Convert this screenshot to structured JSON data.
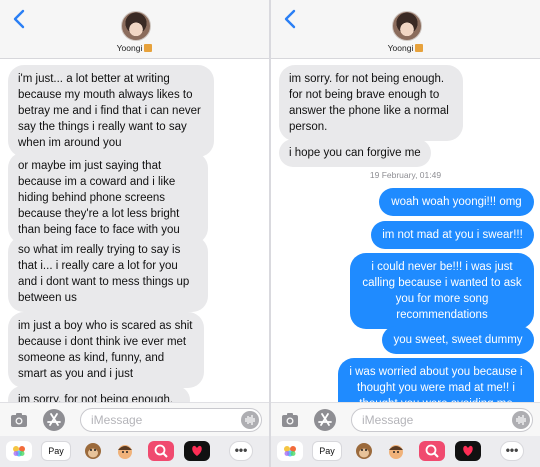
{
  "contact": {
    "name": "Yoongi"
  },
  "left": {
    "messages": [
      {
        "text": "i'm just... a lot better at writing because my mouth always likes to betray me and i find that i can never say the things i really want to say when im around you"
      },
      {
        "text": "or maybe im just saying that because im a coward and i like hiding behind phone screens because they're a lot less bright than being face to face with you"
      },
      {
        "text": "so what im really trying to say is that i... i really care a lot for you and i dont want to mess things up between us"
      },
      {
        "text": "im just a boy who is scared as shit because i dont think ive ever met someone as kind, funny, and smart as you and i just"
      },
      {
        "text": "im sorry. for not being enough."
      }
    ]
  },
  "right": {
    "incoming": [
      {
        "text": "im sorry. for not being enough. for not being brave enough to answer the phone like a normal person."
      },
      {
        "text": "i hope you can forgive me"
      }
    ],
    "timestamp": "19 February, 01:49",
    "outgoing": [
      {
        "text": "woah woah yoongi!!! omg"
      },
      {
        "text": "im not mad at you i swear!!!"
      },
      {
        "text": "i could never be!!! i was just calling because i wanted to ask you for more song recommendations"
      },
      {
        "text": "you sweet, sweet dummy"
      },
      {
        "text": "i was worried about you because i thought you were mad at me!! i thought you were avoiding me"
      }
    ]
  },
  "composer": {
    "placeholder": "iMessage"
  },
  "app_strip": {
    "apple_pay_label": "Pay",
    "more_label": "•••"
  },
  "icons": [
    "back-chevron-icon",
    "camera-icon",
    "app-store-icon",
    "mic-waveform-icon",
    "photos-icon",
    "apple-pay-icon",
    "monkey-memoji-icon",
    "memoji-icon",
    "image-search-icon",
    "digital-touch-icon",
    "more-icon"
  ],
  "colors": {
    "outgoing_bubble": "#1f8bff",
    "incoming_bubble": "#e9e9eb",
    "back_chevron": "#2a7ff5"
  }
}
